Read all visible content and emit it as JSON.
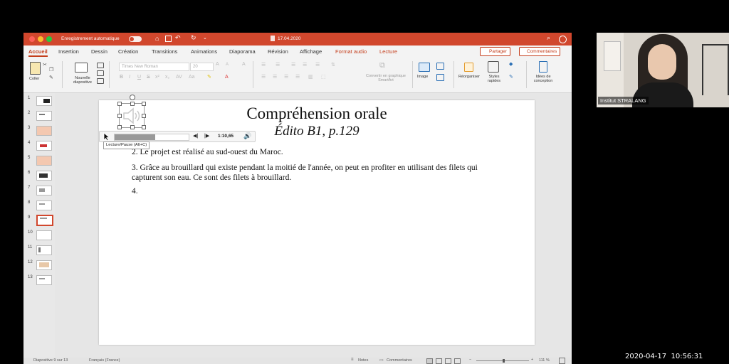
{
  "window": {
    "autosave_label": "Enregistrement automatique",
    "autosave_state": "off",
    "doc_title": "17.04.2020",
    "accent": "#d1472d"
  },
  "menu": {
    "tabs": [
      "Accueil",
      "Insertion",
      "Dessin",
      "Création",
      "Transitions",
      "Animations",
      "Diaporama",
      "Révision",
      "Affichage"
    ],
    "context_tabs": [
      "Format audio",
      "Lecture"
    ],
    "share": "Partager",
    "comments": "Commentaires"
  },
  "ribbon": {
    "paste": "Coller",
    "new_slide": "Nouvelle diapositive",
    "font_name": "Times New Roman",
    "font_size": "20",
    "smartart": "Convertir en graphique SmartArt",
    "image": "Image",
    "arrange": "Réorganiser",
    "quick_styles": "Styles rapides",
    "design_ideas": "Idées de conception"
  },
  "thumbnails": [
    "1",
    "2",
    "3",
    "4",
    "5",
    "6",
    "7",
    "8",
    "9",
    "10",
    "11",
    "12",
    "13"
  ],
  "slide": {
    "title": "Compréhension orale",
    "subtitle": "Édito B1, p.129",
    "items": [
      "2. Le projet est réalisé au sud-ouest du Maroc.",
      "3. Grâce au brouillard qui existe pendant la moitié de l'année, on peut en profiter en utilisant des filets qui capturent son eau. Ce sont des filets à brouillard.",
      "4."
    ]
  },
  "audio": {
    "time": "1:10,65",
    "tooltip": "Lecture/Pause (Alt+C)",
    "progress": 0.55
  },
  "status": {
    "slide_info": "Diapositive 9 sur 13",
    "language": "Français (France)",
    "notes": "Notes",
    "comments": "Commentaires",
    "zoom": "111 %"
  },
  "camera": {
    "name": "Institut STRALANG"
  },
  "clock": "2020-04-17  10:56:31"
}
